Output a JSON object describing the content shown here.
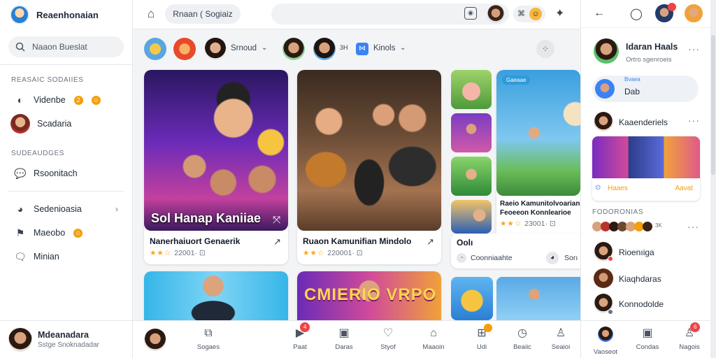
{
  "app": {
    "brand": "Reaenhonaian",
    "search_placeholder": "Naaon Bueslat"
  },
  "sidebar": {
    "section1": "Reasaic Sodaiies",
    "items1": [
      {
        "label": "Videnbe",
        "icon": "compass-icon",
        "badge_count": "2"
      },
      {
        "label": "Scadaria",
        "icon": "avatar"
      }
    ],
    "section2": "Sudeaudges",
    "items2": [
      {
        "label": "Rsoonitach",
        "icon": "chat-icon"
      }
    ],
    "items3": [
      {
        "label": "Sedenioasia",
        "icon": "globe-icon"
      },
      {
        "label": "Maeobo",
        "icon": "flag-icon"
      },
      {
        "label": "Minian",
        "icon": "message-icon"
      }
    ],
    "user": {
      "name": "Mdeanadara",
      "subtitle": "Sstge Snoknadadar"
    }
  },
  "topbar": {
    "breadcrumb": "Rnaan ( Sogiaiz"
  },
  "stories": {
    "label1": "Srnoud",
    "label2": "Kinols",
    "count_text": "3H"
  },
  "feed": {
    "card1": {
      "overlay_title": "Sol Hanap Kaniiae",
      "title": "Nanerhaiuort Genaerik",
      "rating": "★★☆",
      "meta": "22001·"
    },
    "card2": {
      "title": "Ruaon Kamunifian Mindolo",
      "rating": "★★☆",
      "meta": "220001·"
    },
    "card3": {
      "title": "Raeio Kamunitolvoarian",
      "subtitle": "Feoeeon Konnlearioe",
      "rating": "★★☆",
      "meta": "23001·",
      "tag": "Gaeaae"
    },
    "card3b": {
      "title": "Oolı",
      "chip": "Coonniaahte"
    },
    "card4": {
      "overlay_title": "CMIERIO VRPO"
    },
    "side_label": "Sorı"
  },
  "bottomnav": {
    "items": [
      {
        "label": "Sogaes",
        "icon": "puzzle-icon"
      },
      {
        "label": "Paat",
        "icon": "play-icon",
        "badge": "4"
      },
      {
        "label": "Daras",
        "icon": "tablet-icon"
      },
      {
        "label": "Styof",
        "icon": "heart-icon"
      },
      {
        "label": "Maaoin",
        "icon": "bell-icon"
      },
      {
        "label": "Udi",
        "icon": "cart-icon"
      },
      {
        "label": "Beaiic",
        "icon": "clock-icon"
      },
      {
        "label": "Seaioi",
        "icon": "user-icon"
      }
    ]
  },
  "rightpanel": {
    "profile": {
      "name": "Idaran Haals",
      "subtitle": "Ortro sgenroeis"
    },
    "active": {
      "top": "Bvaea",
      "name": "Dab"
    },
    "section_row": {
      "name": "Kaaenderiels"
    },
    "album": {
      "left": "Haaes",
      "right": "Aavat"
    },
    "section2": "Fodoronias",
    "count": "3K",
    "contacts": [
      {
        "name": "Rioenıiga"
      },
      {
        "name": "Kiaqhdaras"
      },
      {
        "name": "Konnodolde"
      }
    ],
    "bottom": [
      {
        "label": "Vaoseot"
      },
      {
        "label": "Condas"
      },
      {
        "label": "Nagois",
        "badge": "6"
      }
    ]
  },
  "colors": {
    "accent": "#3b82f6",
    "badge": "#f59e0b",
    "alert": "#ef4444"
  }
}
